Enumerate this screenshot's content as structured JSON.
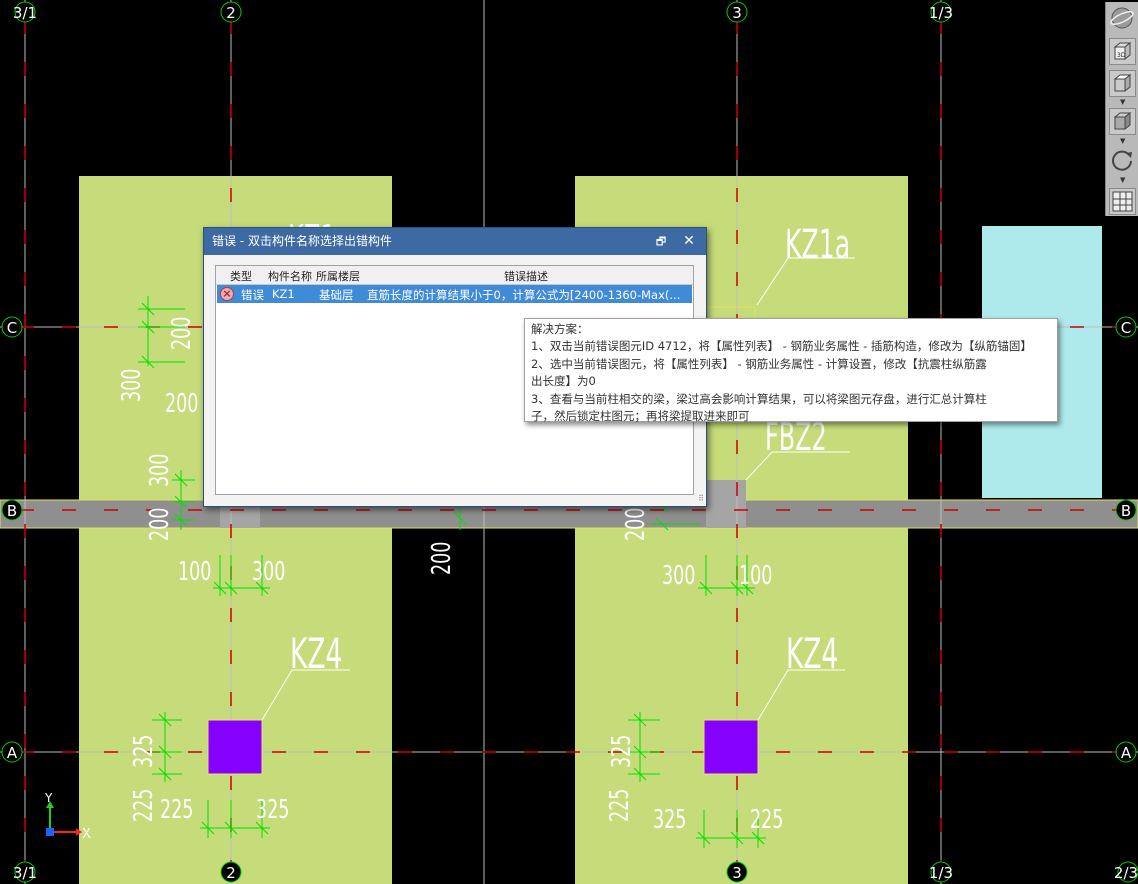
{
  "axes": {
    "top": [
      "3/1",
      "2",
      "3",
      "1/3"
    ],
    "bottom": [
      "3/1",
      "2",
      "3",
      "1/3",
      "2/3"
    ],
    "left": [
      "C",
      "B",
      "A"
    ],
    "right": [
      "C",
      "B",
      "A"
    ]
  },
  "drawing": {
    "column_labels": [
      "KZ1",
      "KZ1a",
      "KZ4",
      "KZ4",
      "FBZ2"
    ],
    "dims": {
      "d200": "200",
      "d300": "300",
      "d100": "100",
      "d325": "325",
      "d225": "225"
    },
    "coord": {
      "x": "X",
      "y": "Y"
    }
  },
  "colors": {
    "slab": "#c6db79",
    "cyan_slab": "#aeeaec",
    "beam": "#909090",
    "column": "#8600ff",
    "dimension": "#00e400",
    "axis_line": "#d00000",
    "grid_line": "#bfbfbf",
    "dialog_title": "#3e6aa4",
    "row_selected": "#3f8bd8"
  },
  "toolbar": {
    "icons": [
      "orbit-sphere-icon",
      "view-3d-cube-icon",
      "view-top-cube-icon",
      "view-front-cube-icon",
      "rotate-icon",
      "layer-grid-icon"
    ],
    "view3d_label": "3D"
  },
  "dialog": {
    "title": "错误 - 双击构件名称选择出错构件",
    "columns": [
      "类型",
      "构件名称",
      "所属楼层",
      "错误描述"
    ],
    "rows": [
      {
        "type": "错误",
        "name": "KZ1",
        "floor": "基础层",
        "description": "直筋长度的计算结果小于0，计算公式为[2400-1360-Max(..."
      }
    ]
  },
  "tooltip": {
    "lines": [
      "解决方案：",
      "1、双击当前错误图元ID 4712，将【属性列表】 - 钢筋业务属性 - 插筋构造，修改为【纵筋锚固】",
      "2、选中当前错误图元，将【属性列表】 - 钢筋业务属性 - 计算设置，修改【抗震柱纵筋露",
      "出长度】为0",
      "3、查看与当前柱相交的梁，梁过高会影响计算结果，可以将梁图元存盘，进行汇总计算柱",
      "子，然后锁定柱图元；再将梁提取进来即可"
    ]
  }
}
